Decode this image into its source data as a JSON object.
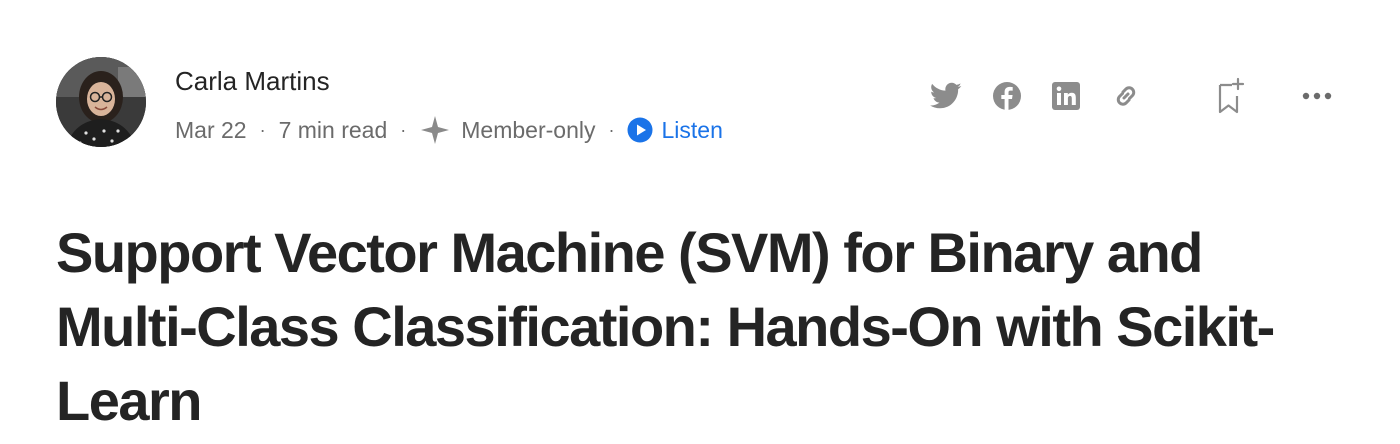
{
  "author": {
    "name": "Carla Martins"
  },
  "meta": {
    "date": "Mar 22",
    "separator": "·",
    "read_time": "7 min read",
    "member_label": "Member-only",
    "listen_label": "Listen"
  },
  "actions": {
    "icons": [
      "twitter-icon",
      "facebook-icon",
      "linkedin-icon",
      "link-icon",
      "bookmark-add-icon",
      "more-icon"
    ]
  },
  "article": {
    "title": "Support Vector Machine (SVM) for Binary and Multi-Class Classification: Hands-On with Scikit-Learn"
  },
  "colors": {
    "text_primary": "#242424",
    "text_secondary": "#6b6b6b",
    "icon_gray": "#8c8c8c",
    "listen_blue": "#1a73e8",
    "member_star": "#8a8a8a"
  }
}
